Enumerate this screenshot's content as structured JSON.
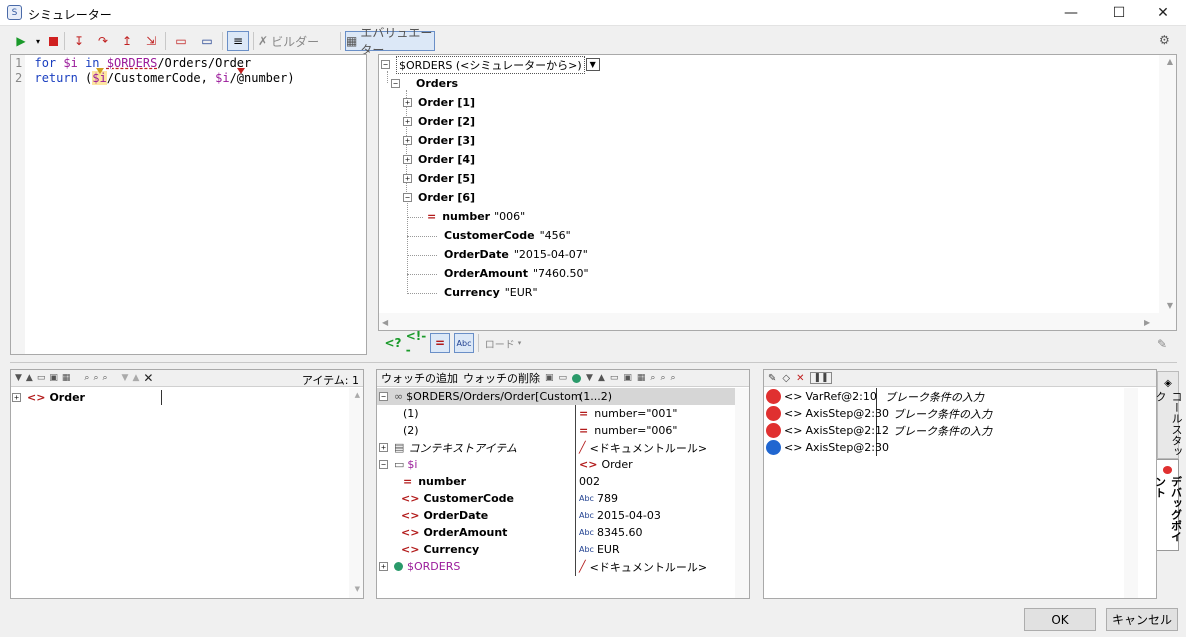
{
  "window": {
    "title": "シミュレーター",
    "minimize": "—",
    "maximize": "☐",
    "close": "✕"
  },
  "toolbar": {
    "builder": "ビルダー",
    "evaluator": "エバリュエーター",
    "load": "ロード"
  },
  "editor": {
    "lines": [
      {
        "n": "1",
        "t": [
          [
            "kw",
            "for "
          ],
          [
            "var",
            "$i "
          ],
          [
            "kw",
            "in "
          ],
          [
            "var",
            "$ORDERS"
          ],
          [
            "",
            "/Orders/Order"
          ]
        ]
      },
      {
        "n": "2",
        "t": [
          [
            "kw",
            "return "
          ],
          [
            "",
            "("
          ],
          [
            "var",
            "$i"
          ],
          [
            "",
            "/CustomerCode, "
          ],
          [
            "var",
            "$i"
          ],
          [
            "",
            "/@number)"
          ]
        ]
      }
    ]
  },
  "result": {
    "root": "$ORDERS (<シミュレーターから>)",
    "orders": "Orders",
    "items": [
      "Order [1]",
      "Order [2]",
      "Order [3]",
      "Order [4]",
      "Order [5]",
      "Order [6]"
    ],
    "attr": {
      "name": "number",
      "value": "\"006\""
    },
    "children": [
      {
        "name": "CustomerCode",
        "value": "\"456\""
      },
      {
        "name": "OrderDate",
        "value": "\"2015-04-07\""
      },
      {
        "name": "OrderAmount",
        "value": "\"7460.50\""
      },
      {
        "name": "Currency",
        "value": "\"EUR\""
      }
    ]
  },
  "context": {
    "count_label": "アイテム: 1",
    "item": "Order"
  },
  "watch": {
    "add": "ウォッチの追加",
    "remove": "ウォッチの削除",
    "rows": [
      {
        "k": "$ORDERS/Orders/Order[Custom",
        "v": "(1...2)"
      },
      {
        "k": "(1)",
        "v": "number=\"001\""
      },
      {
        "k": "(2)",
        "v": "number=\"006\""
      },
      {
        "k": "コンテキストアイテム",
        "v": "<ドキュメントルール>"
      },
      {
        "k": "$i",
        "v": "Order"
      },
      {
        "k": "number",
        "v": "002"
      },
      {
        "k": "CustomerCode",
        "v": "789"
      },
      {
        "k": "OrderDate",
        "v": "2015-04-03"
      },
      {
        "k": "OrderAmount",
        "v": "8345.60"
      },
      {
        "k": "Currency",
        "v": "EUR"
      },
      {
        "k": "$ORDERS",
        "v": "<ドキュメントルール>"
      }
    ]
  },
  "breakpoints": {
    "rows": [
      {
        "step": "VarRef@2:10",
        "desc": "ブレーク条件の入力",
        "color": "#e03030"
      },
      {
        "step": "AxisStep@2:30",
        "desc": "ブレーク条件の入力",
        "color": "#e03030"
      },
      {
        "step": "AxisStep@2:12",
        "desc": "ブレーク条件の入力",
        "color": "#e03030"
      },
      {
        "step": "AxisStep@2:30",
        "desc": "",
        "color": "#2066d0"
      }
    ],
    "tab_callstack": "コールスタック",
    "tab_breakpoints": "デバッグポイント"
  },
  "buttons": {
    "ok": "OK",
    "cancel": "キャンセル"
  }
}
